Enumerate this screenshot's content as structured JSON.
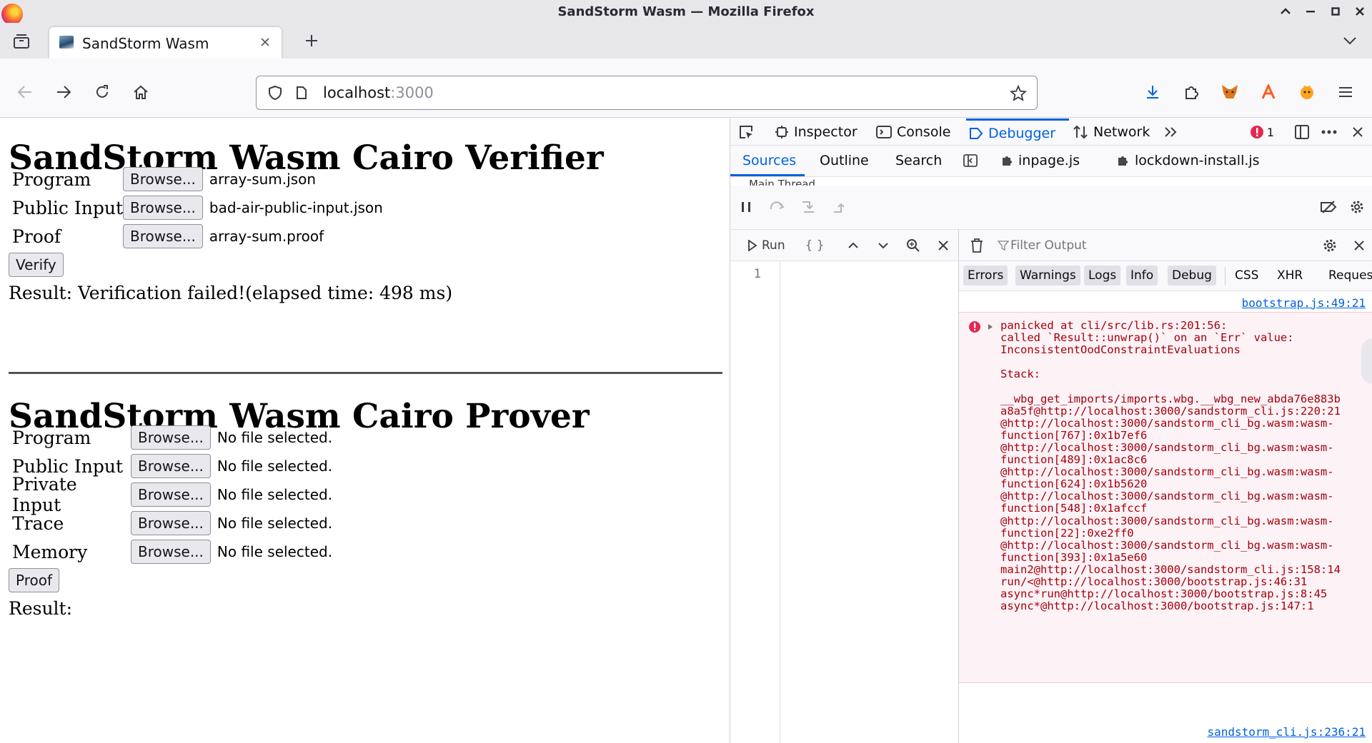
{
  "window": {
    "title": "SandStorm Wasm — Mozilla Firefox"
  },
  "tab": {
    "title": "SandStorm Wasm"
  },
  "url": {
    "host": "localhost",
    "port": ":3000"
  },
  "page": {
    "verifier": {
      "heading": "SandStorm Wasm Cairo Verifier",
      "rows": [
        {
          "label": "Program",
          "button": "Browse...",
          "file": "array-sum.json"
        },
        {
          "label": "Public Input",
          "button": "Browse...",
          "file": "bad-air-public-input.json"
        },
        {
          "label": "Proof",
          "button": "Browse...",
          "file": "array-sum.proof"
        }
      ],
      "action": "Verify",
      "result": "Result: Verification failed!(elapsed time: 498 ms)"
    },
    "prover": {
      "heading": "SandStorm Wasm Cairo Prover",
      "rows": [
        {
          "label": "Program",
          "button": "Browse...",
          "file": "No file selected."
        },
        {
          "label": "Public Input",
          "button": "Browse...",
          "file": "No file selected."
        },
        {
          "label": "Private Input",
          "button": "Browse...",
          "file": "No file selected."
        },
        {
          "label": "Trace",
          "button": "Browse...",
          "file": "No file selected."
        },
        {
          "label": "Memory",
          "button": "Browse...",
          "file": "No file selected."
        }
      ],
      "action": "Proof",
      "result": "Result:"
    }
  },
  "devtools": {
    "tabs": {
      "inspector": "Inspector",
      "console": "Console",
      "debugger": "Debugger",
      "network": "Network"
    },
    "error_count": "1",
    "subtabs": {
      "sources": "Sources",
      "outline": "Outline",
      "search": "Search"
    },
    "source_files": [
      "inpage.js",
      "lockdown-install.js"
    ],
    "main_thread": "Main Thread",
    "editor": {
      "run": "Run",
      "pretty": "{ }",
      "line": "1"
    },
    "console": {
      "filter_placeholder": "Filter Output",
      "filters": [
        "Errors",
        "Warnings",
        "Logs",
        "Info",
        "Debug"
      ],
      "extra_filters": [
        "CSS",
        "XHR",
        "Requests"
      ],
      "top_link": "bootstrap.js:49:21",
      "error_text": "panicked at cli/src/lib.rs:201:56:\ncalled `Result::unwrap()` on an `Err` value:\nInconsistentOodConstraintEvaluations\n\nStack:\n\n__wbg_get_imports/imports.wbg.__wbg_new_abda76e883b\na8a5f@http://localhost:3000/sandstorm_cli.js:220:21\n@http://localhost:3000/sandstorm_cli_bg.wasm:wasm-\nfunction[767]:0x1b7ef6\n@http://localhost:3000/sandstorm_cli_bg.wasm:wasm-\nfunction[489]:0x1ac8c6\n@http://localhost:3000/sandstorm_cli_bg.wasm:wasm-\nfunction[624]:0x1b5620\n@http://localhost:3000/sandstorm_cli_bg.wasm:wasm-\nfunction[548]:0x1afccf\n@http://localhost:3000/sandstorm_cli_bg.wasm:wasm-\nfunction[22]:0xe2ff0\n@http://localhost:3000/sandstorm_cli_bg.wasm:wasm-\nfunction[393]:0x1a5e60\nmain2@http://localhost:3000/sandstorm_cli.js:158:14\nrun/<@http://localhost:3000/bootstrap.js:46:31\nasync*run@http://localhost:3000/bootstrap.js:8:45\nasync*@http://localhost:3000/bootstrap.js:147:1",
      "bottom_link": "sandstorm_cli.js:236:21"
    }
  },
  "colors": {
    "accent": "#0061e0",
    "error": "#a4000f",
    "error_bg": "#fdf2f5",
    "chrome_bg": "#e8e7ea"
  }
}
